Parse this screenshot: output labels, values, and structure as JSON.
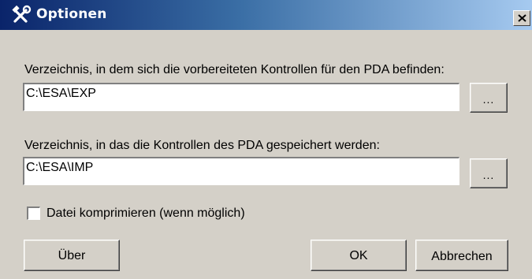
{
  "dialog": {
    "title": "Optionen",
    "icon": "tools-icon"
  },
  "export_dir": {
    "label": "Verzeichnis, in dem sich die vorbereiteten Kontrollen für den PDA befinden:",
    "value": "C:\\ESA\\EXP",
    "browse_label": "..."
  },
  "import_dir": {
    "label": "Verzeichnis, in das die Kontrollen des PDA gespeichert werden:",
    "value": "C:\\ESA\\IMP",
    "browse_label": "..."
  },
  "compress": {
    "label": "Datei komprimieren (wenn möglich)",
    "checked": false
  },
  "buttons": {
    "about": "Über",
    "ok": "OK",
    "cancel": "Abbrechen"
  },
  "colors": {
    "face": "#d4d0c8",
    "title_start": "#0a246a",
    "title_end": "#a6caf0",
    "title_text": "#ffffff"
  }
}
